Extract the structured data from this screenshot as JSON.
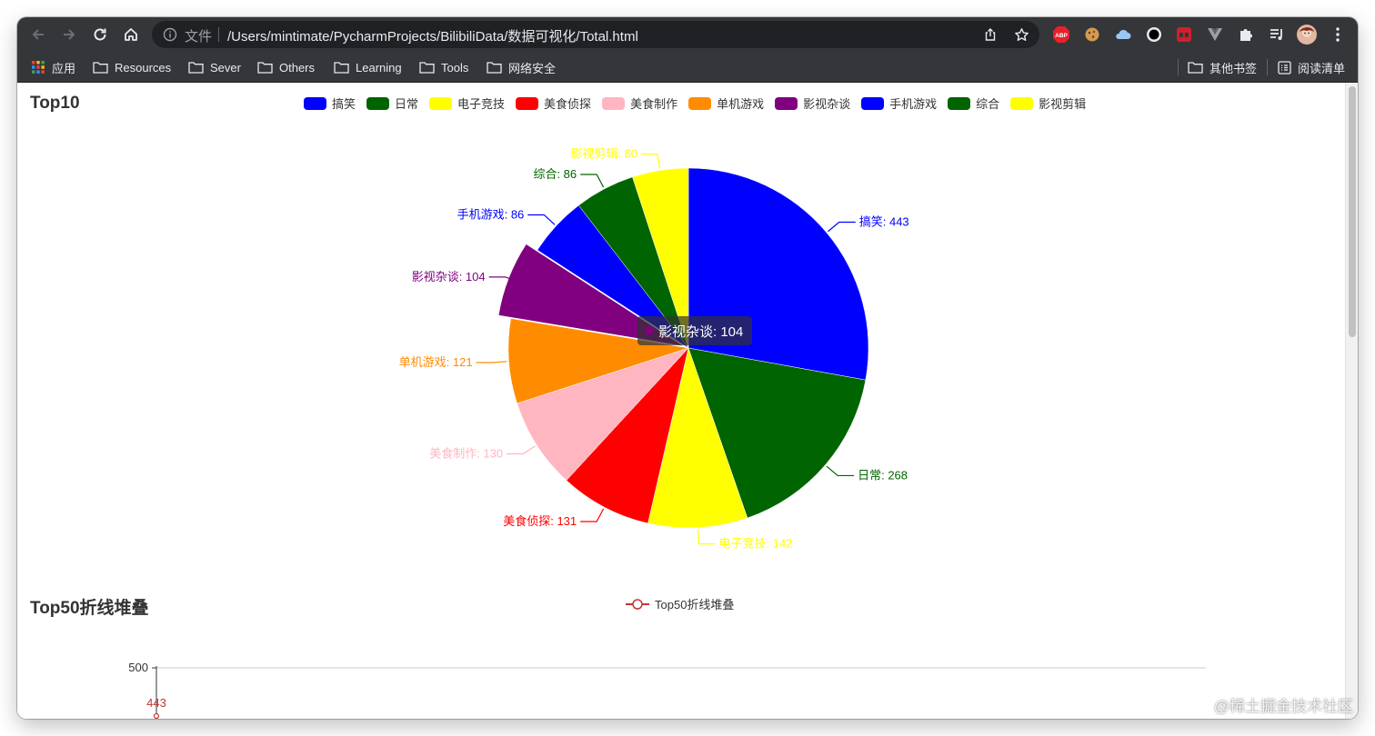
{
  "browser": {
    "omnibox": {
      "file_label": "文件",
      "url": "/Users/mintimate/PycharmProjects/BilibiliData/数据可视化/Total.html"
    },
    "extensions": [
      "abp-icon",
      "cookie-icon",
      "cloud-icon",
      "circle-icon",
      "red-ext-icon",
      "vue-icon",
      "puzzle-icon",
      "media-icon",
      "avatar"
    ],
    "abp_label": "ABP"
  },
  "bookmarks": {
    "apps_label": "应用",
    "items": [
      "Resources",
      "Sever",
      "Others",
      "Learning",
      "Tools",
      "网络安全"
    ],
    "other_label": "其他书签",
    "reading_label": "阅读清单"
  },
  "page": {
    "chart1_title": "Top10",
    "chart2_title": "Top50折线堆叠",
    "tooltip_text": "影视杂谈: 104",
    "watermark": "@稀土掘金技术社区"
  },
  "chart_data": [
    {
      "type": "pie",
      "title": "Top10",
      "categories": [
        "搞笑",
        "日常",
        "电子竞技",
        "美食侦探",
        "美食制作",
        "单机游戏",
        "影视杂谈",
        "手机游戏",
        "综合",
        "影视剪辑"
      ],
      "values": [
        443,
        268,
        142,
        131,
        130,
        121,
        104,
        86,
        86,
        80
      ],
      "colors": [
        "#0000ff",
        "#006400",
        "#ffff00",
        "#ff0000",
        "#ffb6c1",
        "#ff8c00",
        "#800080",
        "#0000ff",
        "#006400",
        "#ffff00"
      ],
      "highlighted": "影视杂谈",
      "legend_position": "top-center"
    },
    {
      "type": "line",
      "title": "Top50折线堆叠",
      "series": [
        {
          "name": "Top50折线堆叠",
          "values": [
            443
          ]
        }
      ],
      "y_ticks": [
        "500"
      ],
      "color": "#c23531",
      "legend_position": "top-center"
    }
  ]
}
